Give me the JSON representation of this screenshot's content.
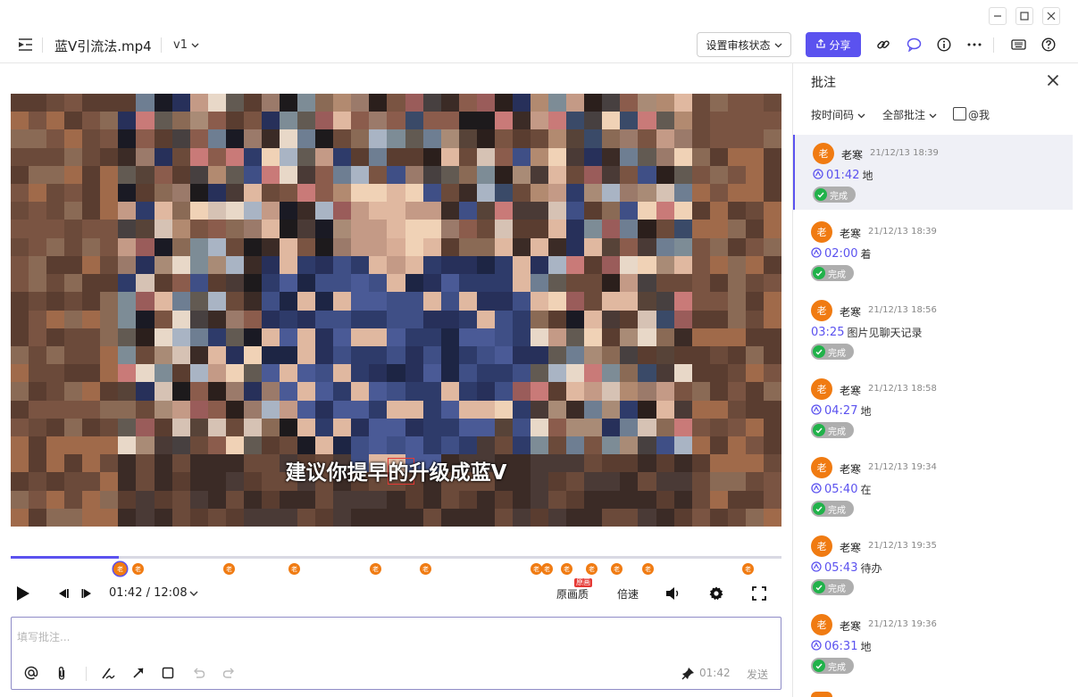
{
  "header": {
    "title": "蓝V引流法.mp4",
    "version": "v1",
    "review_status_label": "设置审核状态",
    "share_label": "分享"
  },
  "video": {
    "subtitle": "建议你提早的升级成蓝V"
  },
  "player": {
    "progress": 0.14,
    "current_time": "01:42",
    "duration": "12:08",
    "quality_label": "原画质",
    "quality_badge": "原画",
    "speed_label": "倍速",
    "marker_glyph": "老"
  },
  "composer": {
    "placeholder": "填写批注...",
    "time": "01:42",
    "send_label": "发送"
  },
  "panel": {
    "title": "批注",
    "sort_label": "按时间码",
    "filter_label": "全部批注",
    "mention_label": "@我",
    "comments": [
      {
        "avatar": "老",
        "name": "老寒",
        "date": "21/12/13 18:39",
        "time": "01:42",
        "text": "地",
        "status": "完成",
        "active": true
      },
      {
        "avatar": "老",
        "name": "老寒",
        "date": "21/12/13 18:39",
        "time": "02:00",
        "text": "着",
        "status": "完成"
      },
      {
        "avatar": "老",
        "name": "老寒",
        "date": "21/12/13 18:56",
        "time": "03:25",
        "text": "图片见聊天记录",
        "status": "完成"
      },
      {
        "avatar": "老",
        "name": "老寒",
        "date": "21/12/13 18:58",
        "time": "04:27",
        "text": "地",
        "status": "完成"
      },
      {
        "avatar": "老",
        "name": "老寒",
        "date": "21/12/13 19:34",
        "time": "05:40",
        "text": "在",
        "status": "完成"
      },
      {
        "avatar": "老",
        "name": "老寒",
        "date": "21/12/13 19:35",
        "time": "05:43",
        "text": "待办",
        "status": "完成"
      },
      {
        "avatar": "老",
        "name": "老寒",
        "date": "21/12/13 19:36",
        "time": "06:31",
        "text": "地",
        "status": "完成"
      }
    ]
  }
}
